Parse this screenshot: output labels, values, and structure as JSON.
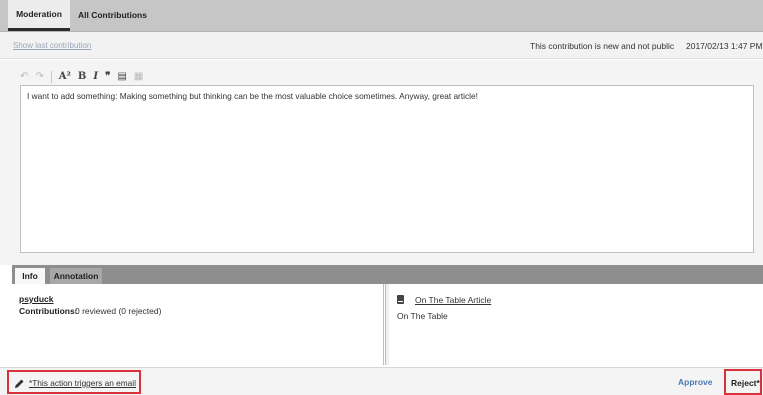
{
  "tabs": [
    "Moderation",
    "All Contributions"
  ],
  "status": {
    "show_last": "Show last contribution",
    "text": "This contribution is new and not public",
    "date": "2017/02/13 1:47 PM"
  },
  "editor": {
    "toolbar": [
      {
        "name": "undo-icon",
        "glyph": "↶"
      },
      {
        "name": "redo-icon",
        "glyph": "↷"
      },
      {
        "name": "font-size-icon",
        "glyph": "A²"
      },
      {
        "name": "bold-icon",
        "glyph": "B"
      },
      {
        "name": "italic-icon",
        "glyph": "I"
      },
      {
        "name": "quote-icon",
        "glyph": "❞"
      },
      {
        "name": "insert-icon",
        "glyph": "▤"
      },
      {
        "name": "media-icon",
        "glyph": "▦"
      }
    ],
    "content": "I want to add something: Making something but thinking can be the most valuable choice sometimes. Anyway, great article!"
  },
  "info": {
    "tabs": [
      "Info",
      "Annotation"
    ],
    "author": "psyduck",
    "contributions_label": "Contributions:",
    "contributions_value": "0 reviewed (0 rejected)",
    "article_link": "On The Table Article",
    "article_sub": "On The Table"
  },
  "actions": {
    "email_note": "*This action triggers an email",
    "approve": "Approve",
    "reject": "Reject*"
  },
  "colors": {
    "accent_blue": "#4a79b5",
    "highlight_red": "#d8333b"
  }
}
